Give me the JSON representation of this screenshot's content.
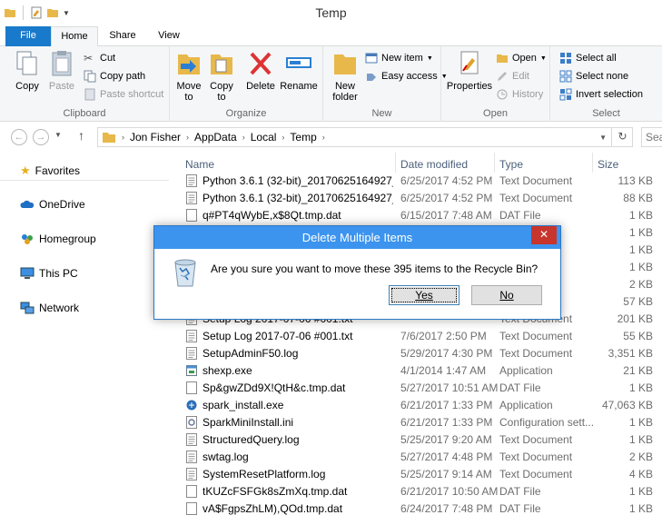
{
  "window": {
    "title": "Temp"
  },
  "ribbon_tabs": [
    "File",
    "Home",
    "Share",
    "View"
  ],
  "clipboard": {
    "copy": "Copy",
    "paste": "Paste",
    "cut": "Cut",
    "copy_path": "Copy path",
    "paste_shortcut": "Paste shortcut",
    "label": "Clipboard"
  },
  "organize": {
    "move_to_1": "Move",
    "move_to_2": "to",
    "copy_to_1": "Copy",
    "copy_to_2": "to",
    "delete": "Delete",
    "rename": "Rename",
    "label": "Organize"
  },
  "new_group": {
    "new_folder_1": "New",
    "new_folder_2": "folder",
    "new_item": "New item",
    "easy_access": "Easy access",
    "label": "New"
  },
  "open_group": {
    "properties": "Properties",
    "open": "Open",
    "edit": "Edit",
    "history": "History",
    "label": "Open"
  },
  "select_group": {
    "select_all": "Select all",
    "select_none": "Select none",
    "invert": "Invert selection",
    "label": "Select"
  },
  "address": {
    "crumbs": [
      "Jon Fisher",
      "AppData",
      "Local",
      "Temp"
    ],
    "search_placeholder": "Sea"
  },
  "nav_pane": {
    "items": [
      "Favorites",
      "OneDrive",
      "Homegroup",
      "This PC",
      "Network"
    ]
  },
  "columns": [
    "Name",
    "Date modified",
    "Type",
    "Size"
  ],
  "files": [
    {
      "name": "Python 3.6.1 (32-bit)_20170625164927_00...",
      "date": "6/25/2017 4:52 PM",
      "type": "Text Document",
      "size": "113 KB",
      "icon": "text-file-icon"
    },
    {
      "name": "Python 3.6.1 (32-bit)_20170625164927_01...",
      "date": "6/25/2017 4:52 PM",
      "type": "Text Document",
      "size": "88 KB",
      "icon": "text-file-icon"
    },
    {
      "name": "q#PT4qWybE,x$8Qt.tmp.dat",
      "date": "6/15/2017 7:48 AM",
      "type": "DAT File",
      "size": "1 KB",
      "icon": "file-icon"
    },
    {
      "name": "",
      "date": "",
      "type": "",
      "size": "1 KB",
      "icon": "file-icon"
    },
    {
      "name": "",
      "date": "",
      "type": "",
      "size": "1 KB",
      "icon": "file-icon"
    },
    {
      "name": "",
      "date": "",
      "type": "",
      "size": "1 KB",
      "icon": "file-icon"
    },
    {
      "name": "",
      "date": "",
      "type": "t",
      "size": "2 KB",
      "icon": "file-icon"
    },
    {
      "name": "",
      "date": "",
      "type": "t",
      "size": "57 KB",
      "icon": "file-icon"
    },
    {
      "name": "Setup Log 2017-07-06 #001.txt",
      "date": "",
      "type": "Text Document",
      "size": "201 KB",
      "icon": "text-file-icon"
    },
    {
      "name": "Setup Log 2017-07-06 #001.txt",
      "date": "7/6/2017 2:50 PM",
      "type": "Text Document",
      "size": "55 KB",
      "icon": "text-file-icon"
    },
    {
      "name": "SetupAdminF50.log",
      "date": "5/29/2017 4:30 PM",
      "type": "Text Document",
      "size": "3,351 KB",
      "icon": "text-file-icon"
    },
    {
      "name": "shexp.exe",
      "date": "4/1/2014 1:47 AM",
      "type": "Application",
      "size": "21 KB",
      "icon": "app-icon"
    },
    {
      "name": "Sp&gwZDd9X!QtH&c.tmp.dat",
      "date": "5/27/2017 10:51 AM",
      "type": "DAT File",
      "size": "1 KB",
      "icon": "file-icon"
    },
    {
      "name": "spark_install.exe",
      "date": "6/21/2017 1:33 PM",
      "type": "Application",
      "size": "47,063 KB",
      "icon": "spark-app-icon"
    },
    {
      "name": "SparkMiniInstall.ini",
      "date": "6/21/2017 1:33 PM",
      "type": "Configuration sett...",
      "size": "1 KB",
      "icon": "config-file-icon"
    },
    {
      "name": "StructuredQuery.log",
      "date": "5/25/2017 9:20 AM",
      "type": "Text Document",
      "size": "1 KB",
      "icon": "text-file-icon"
    },
    {
      "name": "swtag.log",
      "date": "5/27/2017 4:48 PM",
      "type": "Text Document",
      "size": "2 KB",
      "icon": "text-file-icon"
    },
    {
      "name": "SystemResetPlatform.log",
      "date": "5/25/2017 9:14 AM",
      "type": "Text Document",
      "size": "4 KB",
      "icon": "text-file-icon"
    },
    {
      "name": "tKUZcFSFGk8sZmXq.tmp.dat",
      "date": "6/21/2017 10:50 AM",
      "type": "DAT File",
      "size": "1 KB",
      "icon": "file-icon"
    },
    {
      "name": "vA$FgpsZhLM),QOd.tmp.dat",
      "date": "6/24/2017 7:48 PM",
      "type": "DAT File",
      "size": "1 KB",
      "icon": "file-icon"
    }
  ],
  "dialog": {
    "title": "Delete Multiple Items",
    "message": "Are you sure you want to move these 395 items to the Recycle Bin?",
    "yes": "Yes",
    "no": "No",
    "close": "✕"
  },
  "colors": {
    "accent": "#1979ca",
    "dialog_title": "#3c94ee",
    "close_red": "#c7352c"
  }
}
